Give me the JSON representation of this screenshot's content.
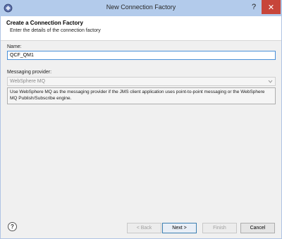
{
  "window": {
    "title": "New Connection Factory",
    "help_glyph": "?",
    "close_glyph": "✕"
  },
  "header": {
    "title": "Create a Connection Factory",
    "description": "Enter the details of the connection factory"
  },
  "form": {
    "name_label": "Name:",
    "name_value": "QCF_QM1",
    "provider_label": "Messaging provider:",
    "provider_value": "WebSphere MQ",
    "provider_description": "Use WebSphere MQ as the messaging provider if the JMS client application uses point-to-point messaging or the WebSphere MQ Publish/Subscribe engine."
  },
  "footer": {
    "help_glyph": "?",
    "back_label": "< Back",
    "next_label": "Next >",
    "finish_label": "Finish",
    "cancel_label": "Cancel"
  },
  "colors": {
    "titlebar": "#b3cbeb",
    "close": "#c7453a",
    "focus_border": "#4a90d9"
  },
  "icons": [
    "app-icon",
    "help-icon",
    "close-icon",
    "chevron-down-icon"
  ]
}
